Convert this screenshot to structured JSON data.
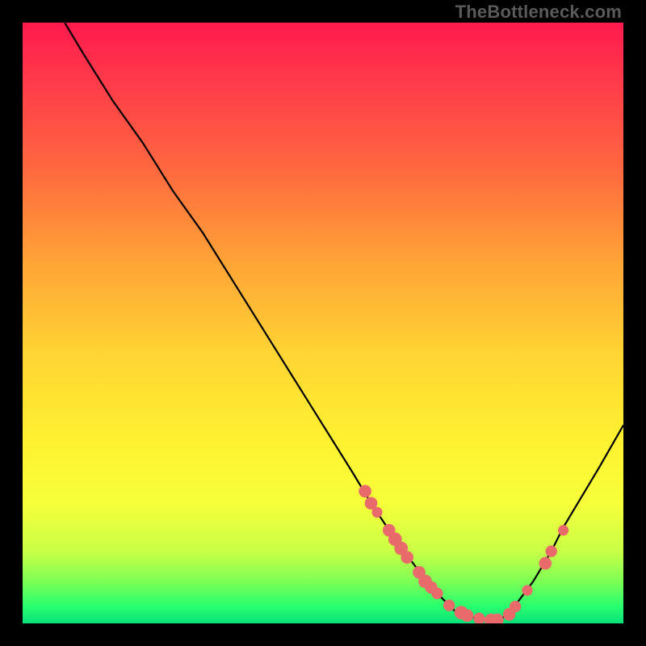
{
  "watermark": "TheBottleneck.com",
  "chart_data": {
    "type": "line",
    "title": "",
    "xlabel": "",
    "ylabel": "",
    "xlim": [
      0,
      100
    ],
    "ylim": [
      0,
      100
    ],
    "series": [
      {
        "name": "bottleneck-curve",
        "x": [
          7,
          10,
          15,
          20,
          25,
          30,
          35,
          40,
          45,
          50,
          55,
          58,
          60,
          62,
          65,
          68,
          70,
          72,
          75,
          78,
          80,
          82,
          85,
          88,
          90,
          93,
          96,
          100
        ],
        "y": [
          100,
          95,
          87,
          80,
          72,
          65,
          57,
          49,
          41,
          33,
          25,
          20,
          17,
          14,
          10,
          6,
          4,
          2,
          1,
          0.5,
          1,
          3,
          7,
          12,
          16,
          21,
          26,
          33
        ]
      }
    ],
    "markers": [
      {
        "x": 57,
        "y": 22,
        "r": 1.3
      },
      {
        "x": 58,
        "y": 20,
        "r": 1.3
      },
      {
        "x": 59,
        "y": 18.5,
        "r": 1.1
      },
      {
        "x": 61,
        "y": 15.5,
        "r": 1.3
      },
      {
        "x": 62,
        "y": 14,
        "r": 1.4
      },
      {
        "x": 63,
        "y": 12.5,
        "r": 1.4
      },
      {
        "x": 64,
        "y": 11,
        "r": 1.3
      },
      {
        "x": 66,
        "y": 8.5,
        "r": 1.3
      },
      {
        "x": 67,
        "y": 7,
        "r": 1.4
      },
      {
        "x": 68,
        "y": 6,
        "r": 1.3
      },
      {
        "x": 69,
        "y": 5,
        "r": 1.2
      },
      {
        "x": 71,
        "y": 3,
        "r": 1.2
      },
      {
        "x": 73,
        "y": 1.8,
        "r": 1.4
      },
      {
        "x": 74,
        "y": 1.3,
        "r": 1.3
      },
      {
        "x": 76,
        "y": 0.8,
        "r": 1.2
      },
      {
        "x": 78,
        "y": 0.5,
        "r": 1.4
      },
      {
        "x": 79,
        "y": 0.6,
        "r": 1.3
      },
      {
        "x": 81,
        "y": 1.5,
        "r": 1.3
      },
      {
        "x": 82,
        "y": 2.8,
        "r": 1.2
      },
      {
        "x": 84,
        "y": 5.5,
        "r": 1.1
      },
      {
        "x": 87,
        "y": 10,
        "r": 1.3
      },
      {
        "x": 88,
        "y": 12,
        "r": 1.2
      },
      {
        "x": 90,
        "y": 15.5,
        "r": 1.1
      }
    ],
    "colors": {
      "curve": "#000000",
      "marker": "#e96a6a"
    }
  }
}
